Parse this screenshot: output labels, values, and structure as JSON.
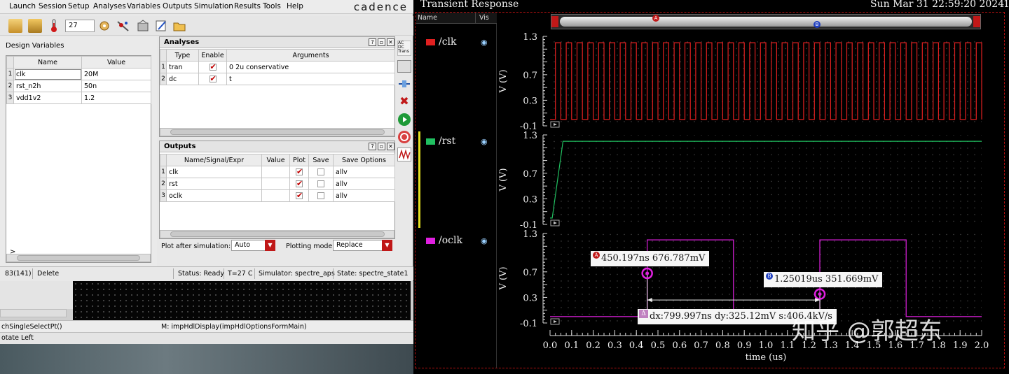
{
  "ade": {
    "menu": [
      "Launch",
      "Session",
      "Setup",
      "Analyses",
      "Variables",
      "Outputs",
      "Simulation",
      "Results",
      "Tools",
      "Help"
    ],
    "brand": "cadence",
    "temperature": "27",
    "design_vars": {
      "title": "Design Variables",
      "headers": [
        "Name",
        "Value"
      ],
      "rows": [
        {
          "n": "1",
          "name": "clk",
          "value": "20M"
        },
        {
          "n": "2",
          "name": "rst_n2h",
          "value": "50n"
        },
        {
          "n": "3",
          "name": "vdd1v2",
          "value": "1.2"
        }
      ]
    },
    "analyses": {
      "title": "Analyses",
      "headers": [
        "Type",
        "Enable",
        "Arguments"
      ],
      "rows": [
        {
          "n": "1",
          "type": "tran",
          "enabled": true,
          "args": "0 2u conservative"
        },
        {
          "n": "2",
          "type": "dc",
          "enabled": true,
          "args": "t"
        }
      ]
    },
    "outputs": {
      "title": "Outputs",
      "headers": [
        "Name/Signal/Expr",
        "Value",
        "Plot",
        "Save",
        "Save Options"
      ],
      "rows": [
        {
          "n": "1",
          "name": "clk",
          "value": "",
          "plot": true,
          "save": false,
          "opt": "allv"
        },
        {
          "n": "2",
          "name": "rst",
          "value": "",
          "plot": true,
          "save": false,
          "opt": "allv"
        },
        {
          "n": "3",
          "name": "oclk",
          "value": "",
          "plot": true,
          "save": false,
          "opt": "allv"
        }
      ]
    },
    "plot_after_label": "Plot after simulation:",
    "plot_after_value": "Auto",
    "plotting_mode_label": "Plotting mode:",
    "plotting_mode_value": "Replace",
    "prompt": ">",
    "status": {
      "left": "83(141)",
      "cmd": "Delete",
      "ready": "Status: Ready",
      "temp": "T=27 C",
      "sim": "Simulator: spectre_aps",
      "state": "State: spectre_state1"
    }
  },
  "below": {
    "line1": "chSingleSelectPt()",
    "line1_right": "M: impHdlDisplay(impHdlOptionsFormMain)",
    "line2": "otate Left"
  },
  "wave": {
    "title": "Transient Response",
    "datetime": "Sun Mar 31 22:59:20 2024",
    "corner": "1",
    "list_headers": [
      "Name",
      "Vis"
    ],
    "signals": [
      {
        "name": "/clk",
        "color": "#e02020"
      },
      {
        "name": "/rst",
        "color": "#20c060"
      },
      {
        "name": "/oclk",
        "color": "#e020e0"
      }
    ],
    "ylabel": "V (V)",
    "yticks": [
      "1.3",
      "0.7",
      "0.3",
      "-0.1"
    ],
    "xlabel": "time (us)",
    "xticks": [
      "0.0",
      "0.1",
      "0.2",
      "0.3",
      "0.4",
      "0.5",
      "0.6",
      "0.7",
      "0.8",
      "0.9",
      "1.0",
      "1.1",
      "1.2",
      "1.3",
      "1.4",
      "1.5",
      "1.6",
      "1.7",
      "1.8",
      "1.9",
      "2.0"
    ],
    "marker_a": "450.197ns 676.787mV",
    "marker_b": "1.25019us 351.669mV",
    "delta": "dx:799.997ns dy:325.12mV s:406.4kV/s",
    "marker_a_tag": "A",
    "marker_b_tag": "B",
    "delta_tag": "Δ",
    "watermark": "知乎 @郭超东"
  },
  "chart_data": [
    {
      "type": "line",
      "title": "/clk",
      "ylabel": "V (V)",
      "xlabel": "time (us)",
      "ylim": [
        -0.1,
        1.3
      ],
      "xlim": [
        0,
        2.0
      ],
      "series": [
        {
          "name": "/clk",
          "kind": "square",
          "period_us": 0.05,
          "low": 0.0,
          "high": 1.2
        }
      ]
    },
    {
      "type": "line",
      "title": "/rst",
      "ylabel": "V (V)",
      "ylim": [
        -0.1,
        1.3
      ],
      "xlim": [
        0,
        2.0
      ],
      "series": [
        {
          "name": "/rst",
          "x": [
            0,
            0.01,
            0.06,
            2.0
          ],
          "y": [
            0,
            0,
            1.2,
            1.2
          ]
        }
      ]
    },
    {
      "type": "line",
      "title": "/oclk",
      "ylabel": "V (V)",
      "ylim": [
        -0.1,
        1.3
      ],
      "xlim": [
        0,
        2.0
      ],
      "series": [
        {
          "name": "/oclk",
          "x": [
            0,
            0.45,
            0.45,
            0.85,
            0.85,
            1.25,
            1.25,
            1.65,
            1.65,
            2.0
          ],
          "y": [
            0,
            0,
            1.2,
            1.2,
            0,
            0,
            1.2,
            1.2,
            0,
            0
          ]
        }
      ],
      "markers": [
        {
          "label": "A",
          "x_us": 0.450197,
          "y": 0.676787
        },
        {
          "label": "B",
          "x_us": 1.25019,
          "y": 0.351669
        }
      ]
    }
  ]
}
